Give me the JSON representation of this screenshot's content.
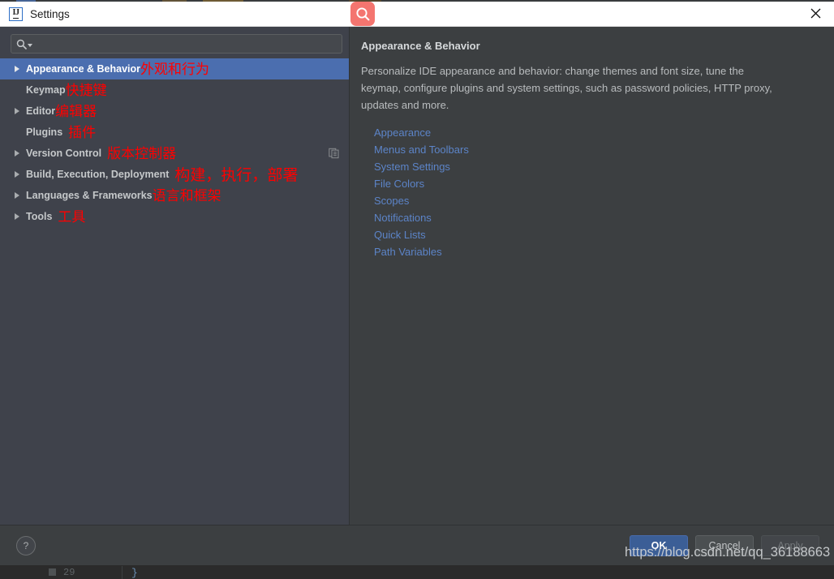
{
  "window": {
    "title": "Settings",
    "app_icon": "intellij-idea-icon",
    "icon_letters": "IJ",
    "close_icon": "close-icon"
  },
  "search_badge": {
    "icon": "search-icon",
    "color": "#f4756f"
  },
  "sidebar": {
    "search": {
      "icon": "search-icon",
      "value": "",
      "placeholder": ""
    },
    "items": [
      {
        "label": "Appearance & Behavior",
        "annotation": "外观和行为",
        "expandable": true,
        "selected": true,
        "trailing_icon": null,
        "annotation_gap": false
      },
      {
        "label": "Keymap",
        "annotation": "快捷键",
        "expandable": false,
        "selected": false,
        "trailing_icon": null,
        "annotation_gap": false
      },
      {
        "label": "Editor",
        "annotation": "编辑器",
        "expandable": true,
        "selected": false,
        "trailing_icon": null,
        "annotation_gap": false
      },
      {
        "label": "Plugins",
        "annotation": "插件",
        "expandable": false,
        "selected": false,
        "trailing_icon": null,
        "annotation_gap": true
      },
      {
        "label": "Version Control",
        "annotation": "版本控制器",
        "expandable": true,
        "selected": false,
        "trailing_icon": "copy-icon",
        "annotation_gap": true
      },
      {
        "label": "Build, Execution, Deployment",
        "annotation": "构建，执行，部署",
        "expandable": true,
        "selected": false,
        "trailing_icon": null,
        "annotation_gap": true
      },
      {
        "label": "Languages & Frameworks",
        "annotation": "语言和框架",
        "expandable": true,
        "selected": false,
        "trailing_icon": null,
        "annotation_gap": false
      },
      {
        "label": "Tools",
        "annotation": "工具",
        "expandable": true,
        "selected": false,
        "trailing_icon": null,
        "annotation_gap": true
      }
    ]
  },
  "detail": {
    "title": "Appearance & Behavior",
    "description": "Personalize IDE appearance and behavior: change themes and font size, tune the keymap, configure plugins and system settings, such as password policies, HTTP proxy, updates and more.",
    "links": [
      "Appearance",
      "Menus and Toolbars",
      "System Settings",
      "File Colors",
      "Scopes",
      "Notifications",
      "Quick Lists",
      "Path Variables"
    ]
  },
  "footer": {
    "help_label": "?",
    "ok_label": "OK",
    "cancel_label": "Cancel",
    "apply_label": "Apply"
  },
  "watermark": {
    "text": "https://blog.csdn.net/qq_36188663"
  },
  "backdrop": {
    "line_number": "29",
    "brace": "}"
  },
  "colors": {
    "selection": "#4b6eaf",
    "annotation": "#ff0000",
    "link": "#5c84c8",
    "panel_left": "#3f424b",
    "panel_right": "#3c3f41",
    "accent_badge": "#f4756f"
  }
}
